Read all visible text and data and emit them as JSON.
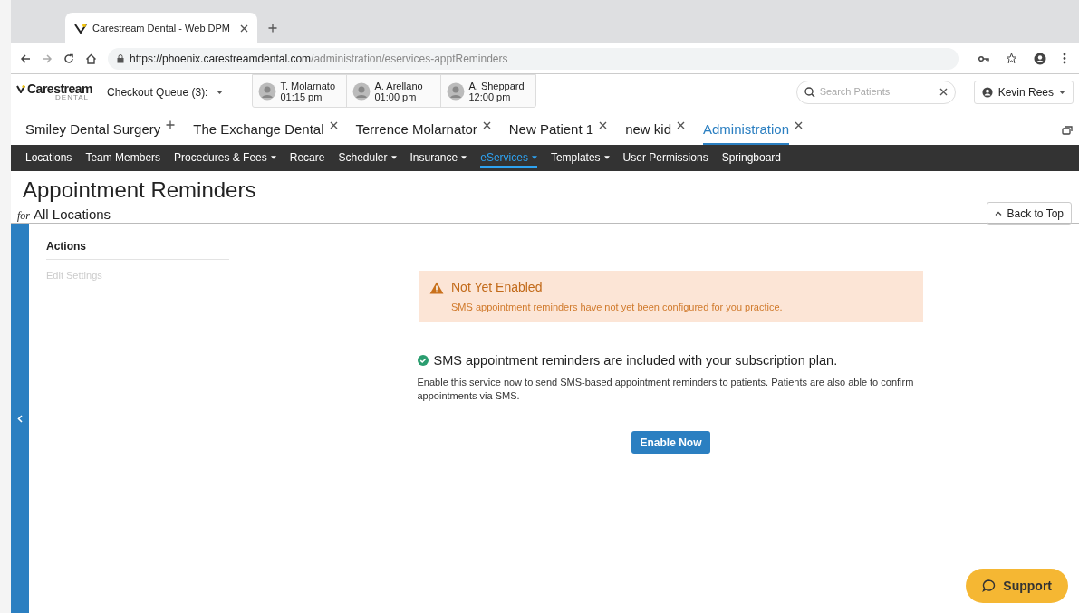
{
  "browser": {
    "tabs": [
      {
        "title": "Carestream Dental - Web DPM",
        "selected": true
      }
    ],
    "url_host": "https://phoenix.carestreamdental.com",
    "url_path": "/administration/eservices-apptReminders"
  },
  "header": {
    "logo": "Carestream",
    "logo_sub": "DENTAL",
    "checkout_queue": "Checkout Queue (3):",
    "queue": [
      {
        "name": "T. Molarnato",
        "time": "01:15 pm"
      },
      {
        "name": "A. Arellano",
        "time": "01:00 pm"
      },
      {
        "name": "A. Sheppard",
        "time": "12:00 pm"
      }
    ],
    "search": {
      "placeholder": "Search Patients"
    },
    "user": "Kevin Rees"
  },
  "patient_tabs": [
    {
      "label": "Smiley Dental Surgery",
      "kind": "add",
      "selected": false
    },
    {
      "label": "The Exchange Dental",
      "kind": "close",
      "selected": false
    },
    {
      "label": "Terrence Molarnator",
      "kind": "close",
      "selected": false
    },
    {
      "label": "New Patient 1",
      "kind": "close",
      "selected": false
    },
    {
      "label": "new kid",
      "kind": "close",
      "selected": false
    },
    {
      "label": "Administration",
      "kind": "close",
      "selected": true
    }
  ],
  "nav": [
    {
      "label": "Locations",
      "dropdown": false,
      "selected": false
    },
    {
      "label": "Team Members",
      "dropdown": false,
      "selected": false
    },
    {
      "label": "Procedures & Fees",
      "dropdown": true,
      "selected": false
    },
    {
      "label": "Recare",
      "dropdown": false,
      "selected": false
    },
    {
      "label": "Scheduler",
      "dropdown": true,
      "selected": false
    },
    {
      "label": "Insurance",
      "dropdown": true,
      "selected": false
    },
    {
      "label": "eServices",
      "dropdown": true,
      "selected": true
    },
    {
      "label": "Templates",
      "dropdown": true,
      "selected": false
    },
    {
      "label": "User Permissions",
      "dropdown": false,
      "selected": false
    },
    {
      "label": "Springboard",
      "dropdown": false,
      "selected": false
    }
  ],
  "page": {
    "title": "Appointment Reminders",
    "subtitle_prefix": "for",
    "subtitle": "All Locations",
    "back_to_top": "Back to Top"
  },
  "sidebar": {
    "heading": "Actions",
    "items": [
      {
        "label": "Edit Settings",
        "disabled": true
      }
    ]
  },
  "alert": {
    "title": "Not Yet Enabled",
    "message": "SMS appointment reminders have not yet been configured for you practice."
  },
  "info": {
    "headline": "SMS appointment reminders are included with your subscription plan.",
    "body": "Enable this service now to send SMS-based appointment reminders to patients. Patients are also able to confirm appointments via SMS.",
    "button": "Enable Now"
  },
  "support": "Support"
}
